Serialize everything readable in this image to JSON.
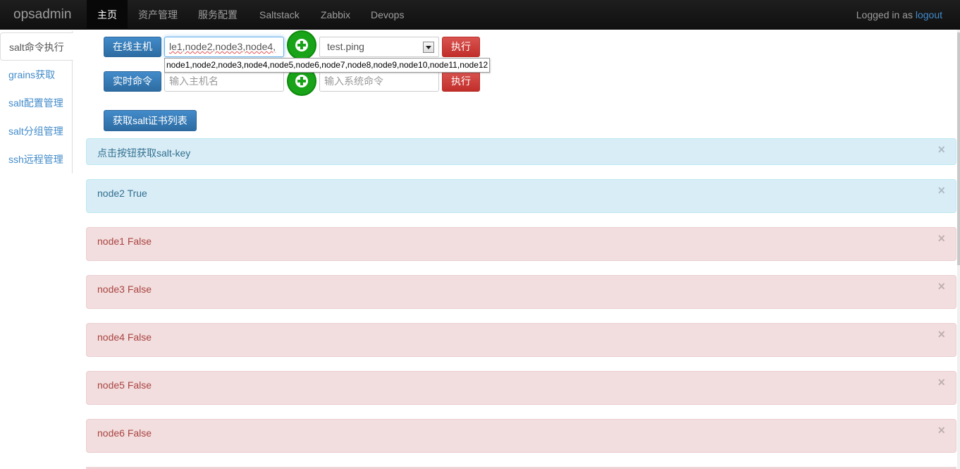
{
  "navbar": {
    "brand": "opsadmin",
    "items": [
      "主页",
      "资产管理",
      "服务配置",
      "Saltstack",
      "Zabbix",
      "Devops"
    ],
    "logged_in_text": "Logged in as",
    "logout_label": "logout"
  },
  "sidebar": {
    "items": [
      "salt命令执行",
      "grains获取",
      "salt配置管理",
      "salt分组管理",
      "ssh远程管理"
    ]
  },
  "row1": {
    "online_hosts_button": "在线主机",
    "hosts_value": "le1,node2,node3,node4,",
    "command_selected": "test.ping",
    "execute_button": "执行"
  },
  "hosts_tooltip": "node1,node2,node3,node4,node5,node6,node7,node8,node9,node10,node11,node12",
  "row2": {
    "realtime_button": "实时命令",
    "host_placeholder": "输入主机名",
    "command_placeholder": "输入系统命令",
    "execute_button": "执行"
  },
  "cert_button": "获取salt证书列表",
  "alerts": [
    {
      "type": "info",
      "text": "点击按钮获取salt-key"
    },
    {
      "type": "info",
      "text": "node2 True"
    },
    {
      "type": "danger",
      "text": "node1 False"
    },
    {
      "type": "danger",
      "text": "node3 False"
    },
    {
      "type": "danger",
      "text": "node4 False"
    },
    {
      "type": "danger",
      "text": "node5 False"
    },
    {
      "type": "danger",
      "text": "node6 False"
    }
  ],
  "close_glyph": "×",
  "colors": {
    "navbar_bg": "#151515",
    "primary": "#428bca",
    "danger": "#d9534f",
    "success": "#19a319",
    "info_bg": "#d9edf7",
    "danger_bg": "#f2dede"
  },
  "icons": {
    "add_host": "plus-circle-icon",
    "add_command": "plus-circle-icon",
    "dropdown": "chevron-down-icon",
    "close": "close-icon"
  }
}
